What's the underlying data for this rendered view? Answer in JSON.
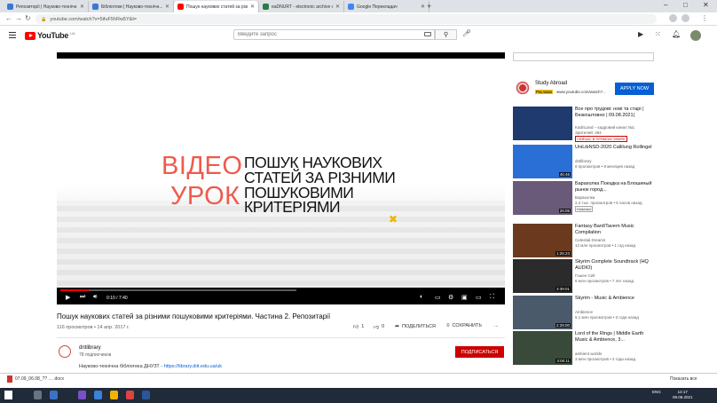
{
  "browser": {
    "tabs": [
      {
        "title": "Репозиторії | Науково-технічн...",
        "color": "#3a78d4",
        "active": false
      },
      {
        "title": "Бібліотеки | Науково-технічн...",
        "color": "#3a78d4",
        "active": false
      },
      {
        "title": "Пошук наукових статей за різн...",
        "color": "#ff0000",
        "active": true
      },
      {
        "title": "eaDNURT - electronic archive of...",
        "color": "#2a7a4a",
        "active": false
      },
      {
        "title": "Google Перекладач",
        "color": "#4285f4",
        "active": false
      }
    ],
    "new_tab": "+",
    "url": "youtube.com/watch?v=5ifuF5hRw5Y&t=",
    "win_min": "–",
    "win_max": "□",
    "win_close": "✕"
  },
  "youtube": {
    "logo_text": "YouTube",
    "logo_country": "UA",
    "search_placeholder": "Введите запрос"
  },
  "video": {
    "frame_word1": "ВІДЕО",
    "frame_word2": "УРОК",
    "frame_lines": [
      "ПОШУК НАУКОВИХ",
      "СТАТЕЙ ЗА РІЗНИМИ",
      "ПОШУКОВИМИ",
      "КРИТЕРІЯМИ"
    ],
    "time": "0:10 / 7:40",
    "progress": 0.12,
    "title": "Пошук наукових статей за різними пошуковими критеріями. Частина 2. Репозитарії",
    "views": "116 просмотров • 14 апр. 2017 г.",
    "likes": "1",
    "dislikes": "0",
    "share": "ПОДЕЛИТЬСЯ",
    "save": "СОХРАНИТЬ",
    "more": "..."
  },
  "channel": {
    "name": "dntlibrary",
    "subs": "78 подписчиков",
    "subscribe": "ПОДПИСАТЬСЯ",
    "desc_text": "Науково-технічна бібліотека ДНУЗТ -",
    "desc_link": "https://library.diit.edu.ua/uk"
  },
  "ad": {
    "title": "Study Abroad",
    "badge": "Реклама",
    "url": "www.youtube.com/watch?...",
    "apply": "APPLY NOW"
  },
  "recommendations": [
    {
      "title": "Все про трудові: нові та старі | Безкоштовно | 09.08.2021|",
      "channel": "KadriLand – кадровий канал №1",
      "meta": "Зрителей: 464",
      "badge": "СЕЙЧАС В ПРЯМОМ ЭФИРЕ",
      "duration": "",
      "thumb": "#1e3a6e"
    },
    {
      "title": "UniLibNSD-2020 Callilung Rollingel",
      "channel": "dntlibrary",
      "meta": "6 просмотров • 8 месяцев назад",
      "badge": "",
      "duration": "45:46",
      "thumb": "#2a6fd6"
    },
    {
      "title": "Барахолка Поездка на Блошиный рынок город...",
      "channel": "Барахолка",
      "meta": "2,4 тыс. просмотров • 5 часов назад",
      "badge": "Новинка",
      "duration": "26:05",
      "thumb": "#6a5a7a"
    },
    {
      "title": "Fantasy Bard/Tavern Music Compilation",
      "channel": "Celestial Dreams",
      "meta": "12 млн просмотров • 1 год назад",
      "badge": "",
      "duration": "1:26:23",
      "thumb": "#6b3a1e"
    },
    {
      "title": "Skyrim Complete Soundtrack (HQ AUDIO)",
      "channel": "Гошен Celt",
      "meta": "6 млн просмотров • 7 лет назад",
      "badge": "",
      "duration": "3:39:01",
      "thumb": "#2b2b2b"
    },
    {
      "title": "Skyrim - Music & Ambience",
      "channel": "Ambience",
      "meta": "5,1 млн просмотров • 2 года назад",
      "badge": "",
      "duration": "2:29:00",
      "thumb": "#4a5a6a"
    },
    {
      "title": "Lord of the Rings | Middle Earth Music & Ambience, 3...",
      "channel": "ambient worlds",
      "meta": "3 млн просмотров • 2 года назад",
      "badge": "",
      "duration": "3:00:11",
      "thumb": "#3a4a3a"
    }
  ],
  "downloads": {
    "file": "07.09_06.08_?? ... .docx",
    "show_all": "Показать все"
  },
  "taskbar": {
    "lang": "ENG",
    "time": "14:17",
    "date": "09.08.2021"
  }
}
